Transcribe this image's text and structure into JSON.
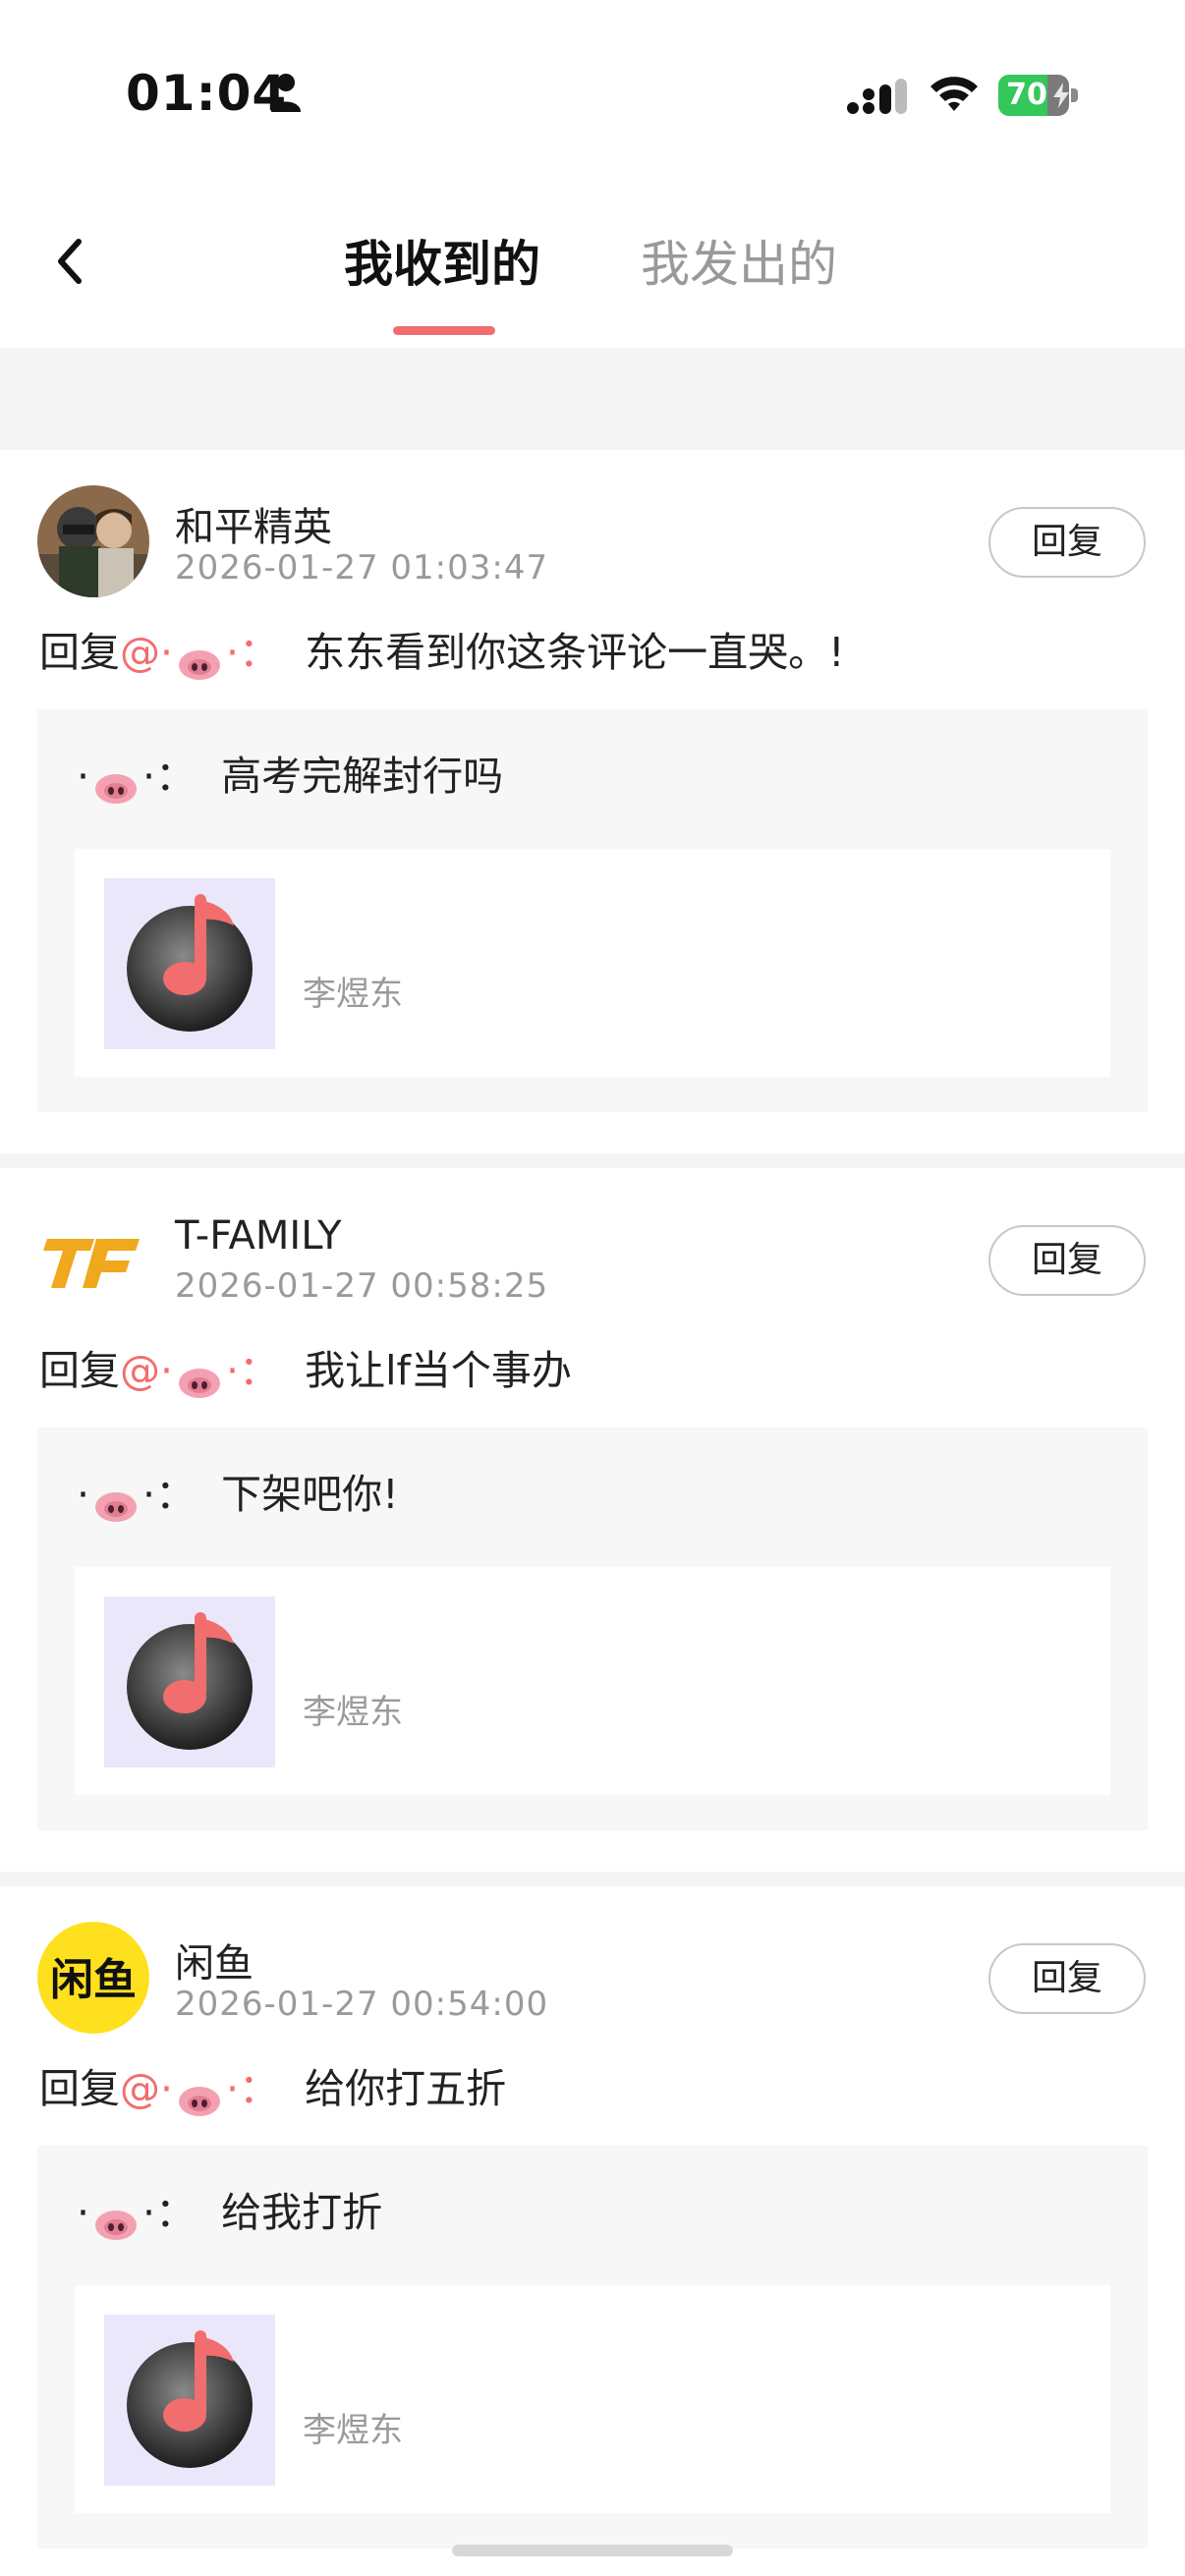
{
  "status_bar": {
    "time": "01:04",
    "battery": "70",
    "battery_level": 0.7
  },
  "nav": {
    "tabs": [
      {
        "label": "我收到的",
        "active": true
      },
      {
        "label": "我发出的",
        "active": false
      }
    ]
  },
  "colors": {
    "accent": "#f26d6d",
    "gray_text": "#9a9a9a",
    "quote_bg": "#f7f7f7",
    "music_thumb_bg": "#ebe7fb"
  },
  "comments": [
    {
      "avatar_icon": "game-soldiers-avatar",
      "username": "和平精英",
      "timestamp": "2026-01-27 01:03:47",
      "reply_label": "回复",
      "reply_prefix": "回复",
      "at_sign": "@",
      "target_nick_dot": "·",
      "target_nick_suffix": "·：",
      "text": "东东看到你这条评论一直哭。!",
      "quoted": {
        "nick_prefix": "·",
        "nick_suffix": "·：",
        "text": "高考完解封行吗"
      },
      "music": {
        "icon": "music-note-icon",
        "artist": "李煜东"
      }
    },
    {
      "avatar_icon": "tf-logo-avatar",
      "username": "T-FAMILY",
      "timestamp": "2026-01-27 00:58:25",
      "reply_label": "回复",
      "reply_prefix": "回复",
      "at_sign": "@",
      "target_nick_dot": "·",
      "target_nick_suffix": "·：",
      "text": "我让lf当个事办",
      "quoted": {
        "nick_prefix": "·",
        "nick_suffix": "·：",
        "text": "下架吧你!"
      },
      "music": {
        "icon": "music-note-icon",
        "artist": "李煜东"
      }
    },
    {
      "avatar_icon": "xianyu-logo-avatar",
      "username": "闲鱼",
      "timestamp": "2026-01-27 00:54:00",
      "reply_label": "回复",
      "reply_prefix": "回复",
      "at_sign": "@",
      "target_nick_dot": "·",
      "target_nick_suffix": "·：",
      "text": "给你打五折",
      "quoted": {
        "nick_prefix": "·",
        "nick_suffix": "·：",
        "text": "给我打折"
      },
      "music": {
        "icon": "music-note-icon",
        "artist": "李煜东"
      }
    }
  ]
}
